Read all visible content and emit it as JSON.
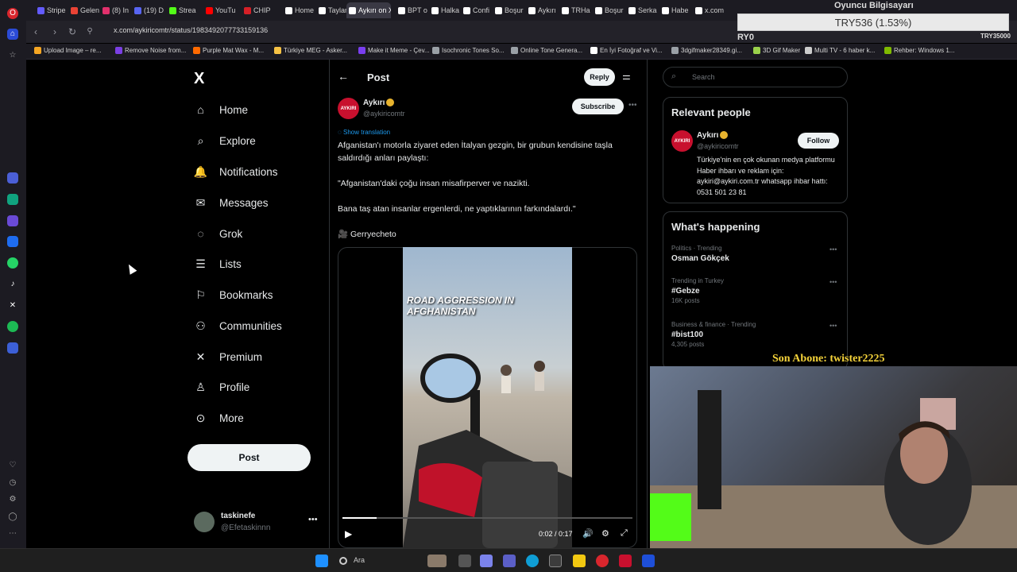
{
  "browser": {
    "tabs": [
      {
        "label": "Stripe",
        "color": "#635bff"
      },
      {
        "label": "Gelen",
        "color": "#ea4335"
      },
      {
        "label": "(8) In",
        "color": "#e1306c"
      },
      {
        "label": "(19) D",
        "color": "#5865f2"
      },
      {
        "label": "Strea",
        "color": "#53fc18"
      },
      {
        "label": "YouTu",
        "color": "#ff0000"
      },
      {
        "label": "CHIP",
        "color": "#d62027"
      },
      {
        "label": "Home",
        "color": "#ffffff"
      },
      {
        "label": "Taylar",
        "color": "#ffffff"
      },
      {
        "label": "Aykırı on X",
        "color": "#ffffff",
        "active": true
      },
      {
        "label": "BPT o",
        "color": "#ffffff"
      },
      {
        "label": "Halka",
        "color": "#ffffff"
      },
      {
        "label": "Confi",
        "color": "#ffffff"
      },
      {
        "label": "Boşur",
        "color": "#ffffff"
      },
      {
        "label": "Aykırı",
        "color": "#ffffff"
      },
      {
        "label": "TRHa",
        "color": "#ffffff"
      },
      {
        "label": "Boşur",
        "color": "#ffffff"
      },
      {
        "label": "Serka",
        "color": "#ffffff"
      },
      {
        "label": "Habe",
        "color": "#ffffff"
      },
      {
        "label": "x.com",
        "color": "#ffffff"
      }
    ],
    "url": "x.com/aykiricomtr/status/1983492077733159136",
    "bookmarks": [
      {
        "label": "Upload Image – re...",
        "color": "#f5a623"
      },
      {
        "label": "Remove Noise from...",
        "color": "#7b3fe4"
      },
      {
        "label": "Purple Mat Wax - M...",
        "color": "#ff6a00"
      },
      {
        "label": "Türkiye MEG - Asker...",
        "color": "#f6c244"
      },
      {
        "label": "Make it Meme - Çev...",
        "color": "#7a3ef0"
      },
      {
        "label": "Isochronic Tones So...",
        "color": "#9aa0a6"
      },
      {
        "label": "Online Tone Genera...",
        "color": "#9aa0a6"
      },
      {
        "label": "En İyi Fotoğraf ve Vi...",
        "color": "#ffffff"
      },
      {
        "label": "3dgifmaker28349.gi...",
        "color": "#9aa0a6"
      },
      {
        "label": "3D Gif Maker",
        "color": "#9ad14b"
      },
      {
        "label": "Multi TV - 6 haber k...",
        "color": "#cccccc"
      },
      {
        "label": "Rehber: Windows 1...",
        "color": "#7fba00"
      }
    ]
  },
  "overlay": {
    "channel_title": "Oyuncu Bilgisayarı",
    "price": "TRY536 (1.53%)",
    "ryo": "RY0",
    "try35": "TRY35000",
    "subscriber": "Son Abone: twister2225"
  },
  "nav": {
    "logo": "X",
    "items": [
      {
        "label": "Home",
        "icon": "home-icon",
        "glyph": "⌂"
      },
      {
        "label": "Explore",
        "icon": "search-icon",
        "glyph": "⌕"
      },
      {
        "label": "Notifications",
        "icon": "bell-icon",
        "glyph": "🔔"
      },
      {
        "label": "Messages",
        "icon": "mail-icon",
        "glyph": "✉"
      },
      {
        "label": "Grok",
        "icon": "grok-icon",
        "glyph": "◌"
      },
      {
        "label": "Lists",
        "icon": "list-icon",
        "glyph": "☰"
      },
      {
        "label": "Bookmarks",
        "icon": "bookmark-icon",
        "glyph": "⚐"
      },
      {
        "label": "Communities",
        "icon": "communities-icon",
        "glyph": "⚇"
      },
      {
        "label": "Premium",
        "icon": "x-premium-icon",
        "glyph": "✕"
      },
      {
        "label": "Profile",
        "icon": "person-icon",
        "glyph": "♙"
      },
      {
        "label": "More",
        "icon": "more-circle-icon",
        "glyph": "⊙"
      }
    ],
    "post_label": "Post",
    "account_name": "taskinefe",
    "account_handle": "@Efetaskinnn"
  },
  "post": {
    "header_title": "Post",
    "reply_label": "Reply",
    "author_name": "Aykırı",
    "author_handle": "@aykiricomtr",
    "avatar_text": "AYKIRI",
    "subscribe_label": "Subscribe",
    "show_translation": "Show translation",
    "text_1": "Afganistan'ı motorla ziyaret eden İtalyan gezgin, bir grubun kendisine taşla saldırdığı anları paylaştı:",
    "text_2": "\"Afganistan'daki çoğu insan misafirperver ve nazikti.",
    "text_3": "Bana taş atan insanlar ergenlerdi, ne yaptıklarının farkındalardı.\"",
    "credit": "🎥 Gerryecheto",
    "video_caption": "ROAD AGGRESSION IN AFGHANISTAN",
    "video_time": "0:02 / 0:17",
    "video_progress": 0.118
  },
  "right": {
    "search_placeholder": "Search",
    "relevant_title": "Relevant people",
    "rp_name": "Aykırı",
    "rp_handle": "@aykiricomtr",
    "follow_label": "Follow",
    "rp_bio": "Türkiye'nin en çok okunan medya platformu Haber ihbarı ve reklam için: aykiri@aykiri.com.tr whatsapp ihbar hattı: 0531 501 23 81",
    "happening_title": "What's happening",
    "trends": [
      {
        "meta": "Politics · Trending",
        "name": "Osman Gökçek",
        "count": ""
      },
      {
        "meta": "Trending in Turkey",
        "name": "#Gebze",
        "count": "16K posts"
      },
      {
        "meta": "Business & finance · Trending",
        "name": "#bist100",
        "count": "4,305 posts"
      }
    ]
  },
  "taskbar": {
    "search_label": "Ara"
  }
}
